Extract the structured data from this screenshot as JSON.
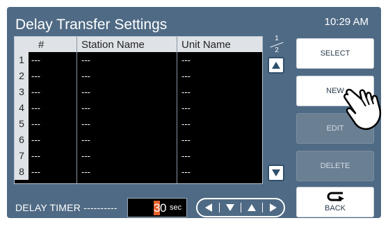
{
  "header": {
    "title": "Delay Transfer Settings",
    "time": "10:29 AM"
  },
  "table": {
    "columns": [
      "#",
      "Station Name",
      "Unit Name"
    ],
    "rows": [
      {
        "num": "1",
        "id": "---",
        "station": "---",
        "unit": "---"
      },
      {
        "num": "2",
        "id": "---",
        "station": "---",
        "unit": "---"
      },
      {
        "num": "3",
        "id": "---",
        "station": "---",
        "unit": "---"
      },
      {
        "num": "4",
        "id": "---",
        "station": "---",
        "unit": "---"
      },
      {
        "num": "5",
        "id": "---",
        "station": "---",
        "unit": "---"
      },
      {
        "num": "6",
        "id": "---",
        "station": "---",
        "unit": "---"
      },
      {
        "num": "7",
        "id": "---",
        "station": "---",
        "unit": "---"
      },
      {
        "num": "8",
        "id": "---",
        "station": "---",
        "unit": "---"
      }
    ]
  },
  "pager": {
    "current": "1",
    "total": "2"
  },
  "buttons": {
    "select": "SELECT",
    "new": "NEW",
    "edit": "EDIT",
    "delete": "DELETE",
    "back": "BACK"
  },
  "delay": {
    "label": "DELAY TIMER ----------",
    "digit_tens": "3",
    "digit_ones": "0",
    "unit": "sec"
  },
  "icons": [
    "scroll-up-icon",
    "scroll-down-icon",
    "nav-left-icon",
    "nav-down-icon",
    "nav-up-icon",
    "nav-right-icon",
    "back-arrow-icon",
    "pointing-hand-icon"
  ],
  "colors": {
    "background": "#4f6a84",
    "table": "#000000",
    "header": "#dfe3e8",
    "accent": "#e4622c"
  }
}
